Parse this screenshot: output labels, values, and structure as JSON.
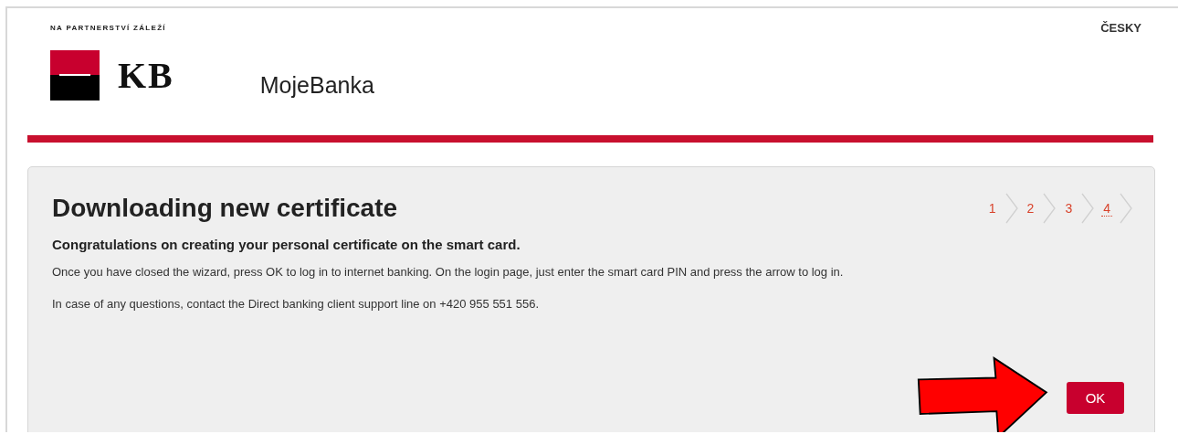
{
  "header": {
    "tagline": "NA PARTNERSTVÍ ZÁLEŽÍ",
    "logo_text": "KB",
    "app_name": "MojeBanka",
    "language": "ČESKY"
  },
  "wizard": {
    "title": "Downloading new certificate",
    "steps": [
      {
        "label": "1",
        "selected": false
      },
      {
        "label": "2",
        "selected": false
      },
      {
        "label": "3",
        "selected": false
      },
      {
        "label": "4",
        "selected": true
      }
    ],
    "heading": "Congratulations on creating your personal certificate on the smart card.",
    "paragraphs": [
      "Once you have closed the wizard, press OK to log in to internet banking. On the login page, just enter the smart card PIN and press the arrow to log in.",
      "In case of any questions, contact the Direct banking client support line on +420 955 551 556."
    ],
    "button": "OK"
  }
}
